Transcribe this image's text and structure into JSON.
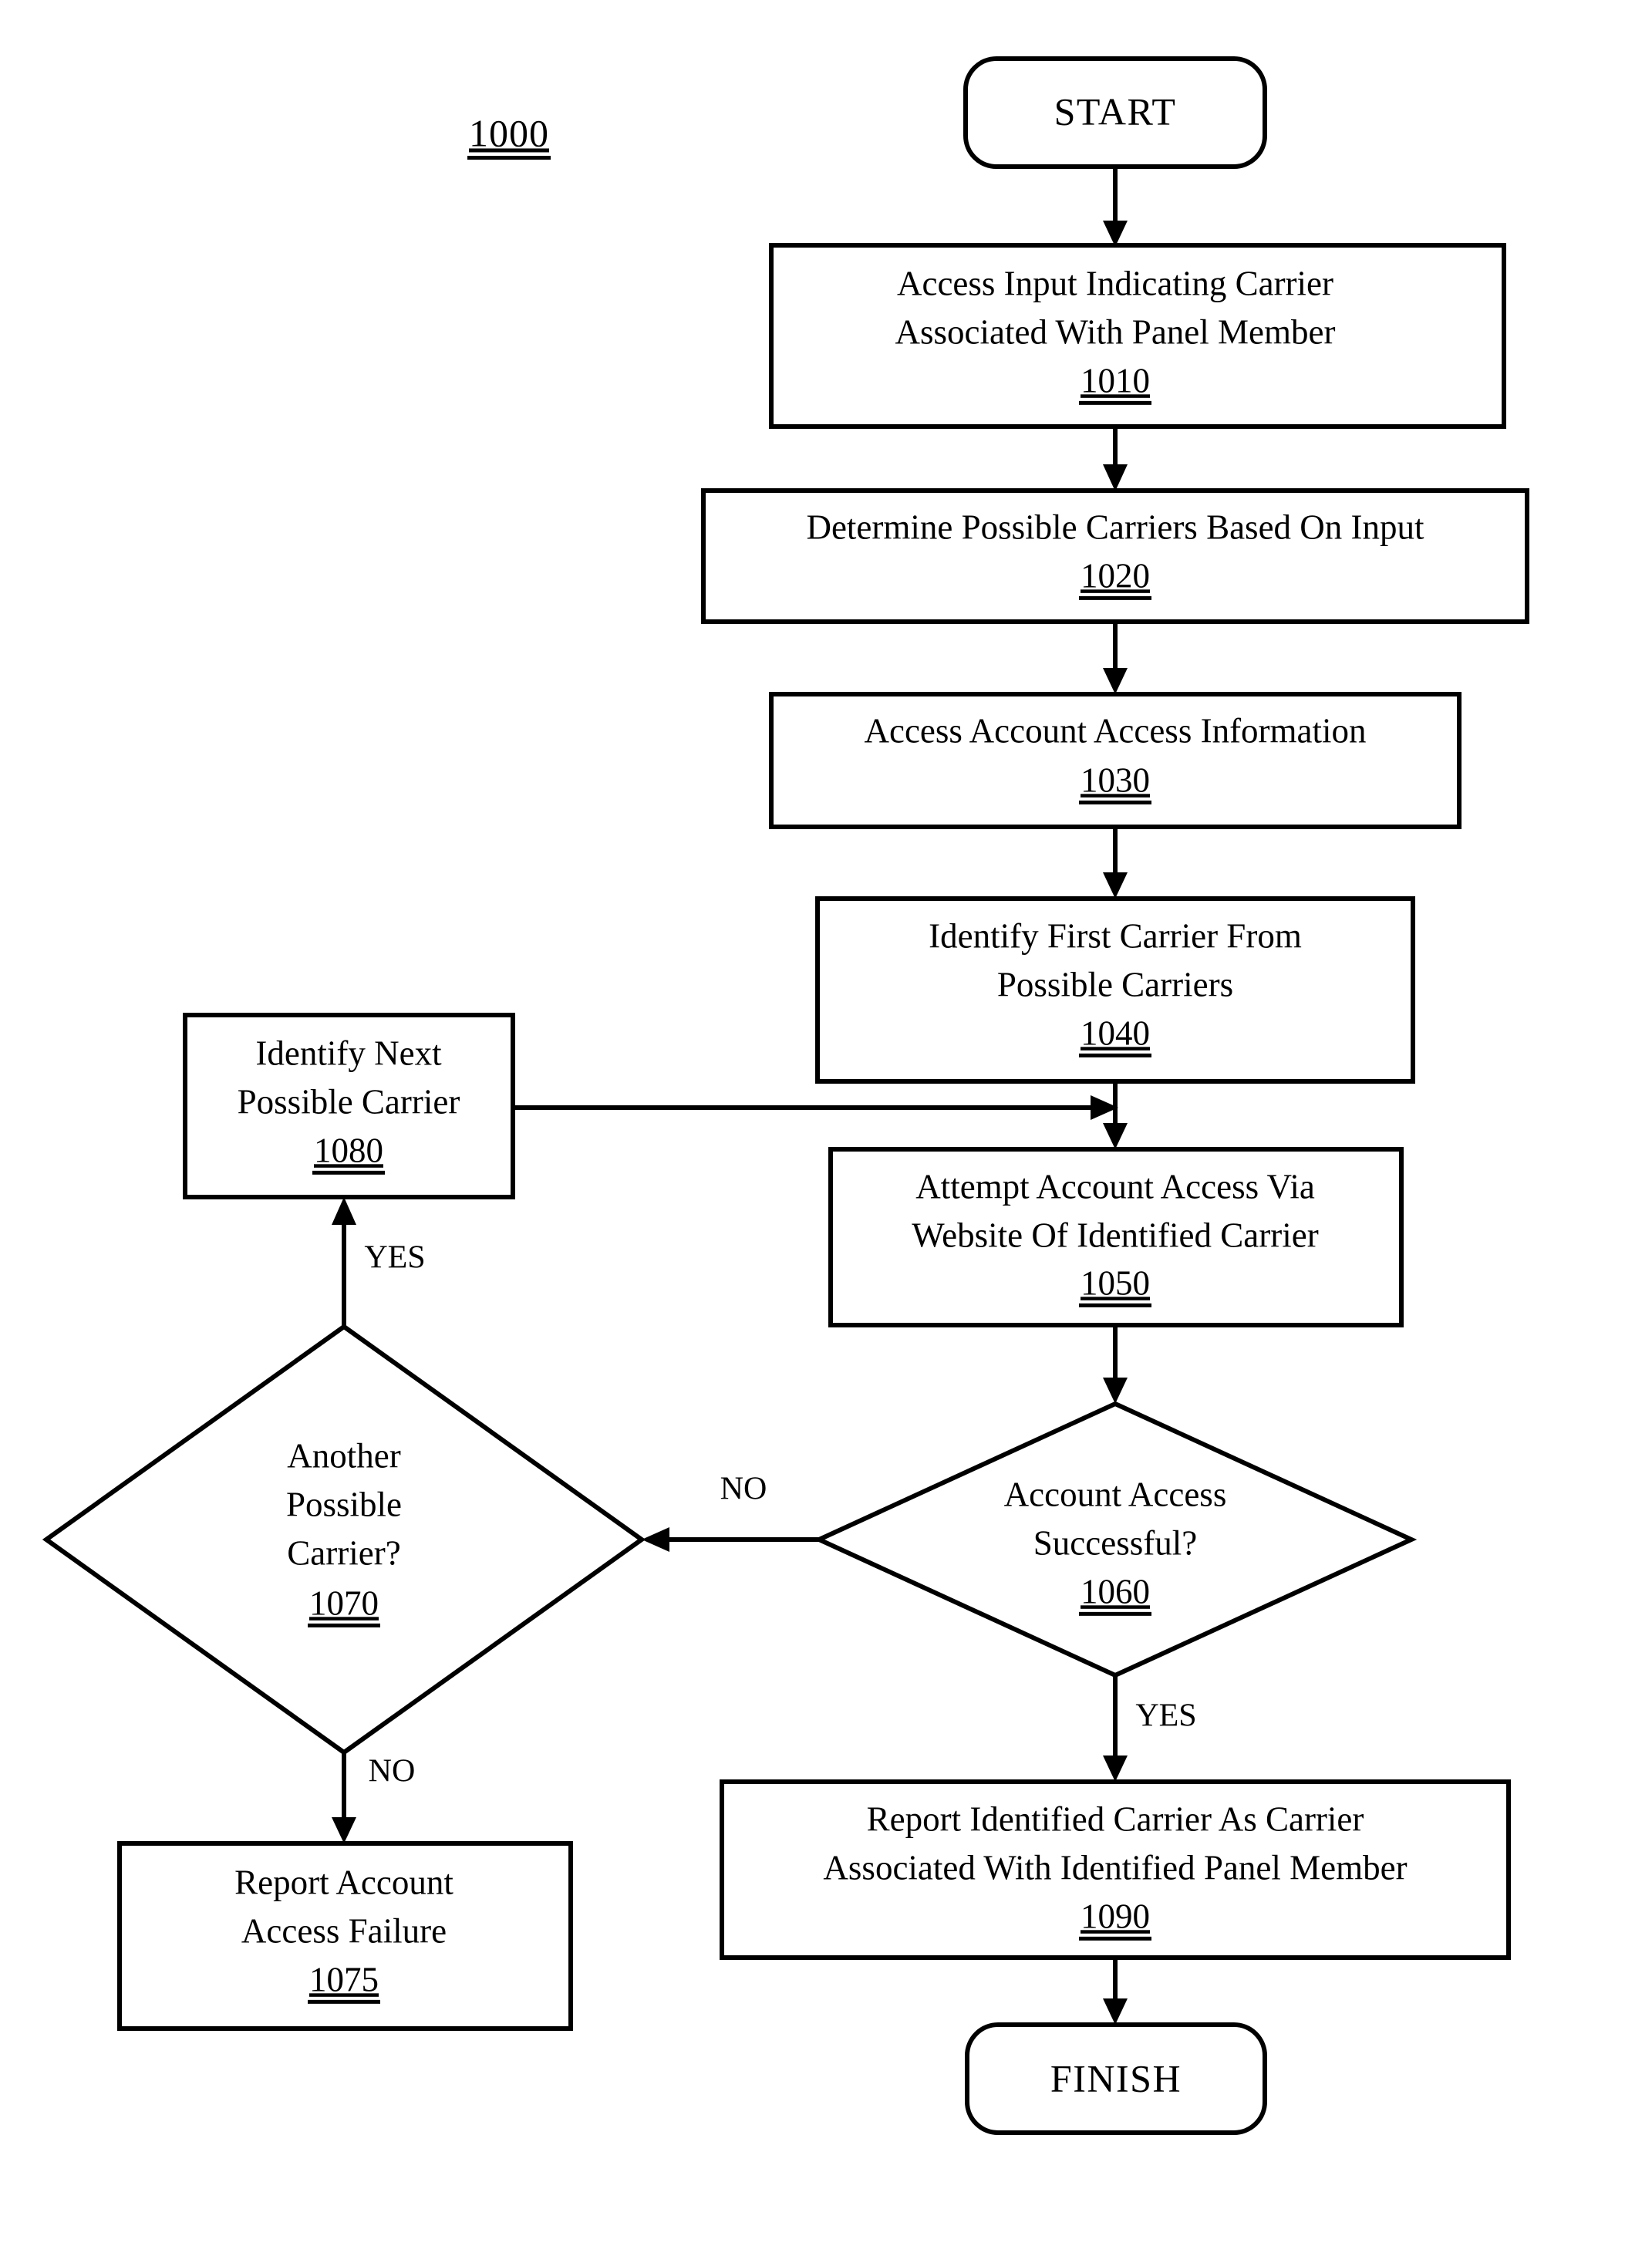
{
  "figure": {
    "label": "1000"
  },
  "nodes": {
    "start": {
      "label": "START",
      "type": "terminator"
    },
    "n1010": {
      "line1": "Access Input Indicating Carrier",
      "line2": "Associated With Panel Member",
      "ref": "1010",
      "type": "process"
    },
    "n1020": {
      "line1": "Determine Possible Carriers Based On Input",
      "ref": "1020",
      "type": "process"
    },
    "n1030": {
      "line1": "Access Account Access Information",
      "ref": "1030",
      "type": "process"
    },
    "n1040": {
      "line1": "Identify First Carrier From",
      "line2": "Possible Carriers",
      "ref": "1040",
      "type": "process"
    },
    "n1080": {
      "line1": "Identify Next",
      "line2": "Possible Carrier",
      "ref": "1080",
      "type": "process"
    },
    "n1050": {
      "line1": "Attempt Account Access Via",
      "line2": "Website Of Identified Carrier",
      "ref": "1050",
      "type": "process"
    },
    "n1060": {
      "line1": "Account Access",
      "line2": "Successful?",
      "ref": "1060",
      "type": "decision"
    },
    "n1070": {
      "line1": "Another",
      "line2": "Possible",
      "line3": "Carrier?",
      "ref": "1070",
      "type": "decision"
    },
    "n1075": {
      "line1": "Report Account",
      "line2": "Access Failure",
      "ref": "1075",
      "type": "process"
    },
    "n1090": {
      "line1": "Report Identified Carrier As Carrier",
      "line2": "Associated With Identified Panel Member",
      "ref": "1090",
      "type": "process"
    },
    "finish": {
      "label": "FINISH",
      "type": "terminator"
    }
  },
  "edge_labels": {
    "no_1060_to_1070": "NO",
    "yes_1060_to_1090": "YES",
    "yes_1070_to_1080": "YES",
    "no_1070_to_1075": "NO"
  },
  "colors": {
    "stroke": "#000000",
    "fill": "#ffffff",
    "background": "#ffffff"
  }
}
